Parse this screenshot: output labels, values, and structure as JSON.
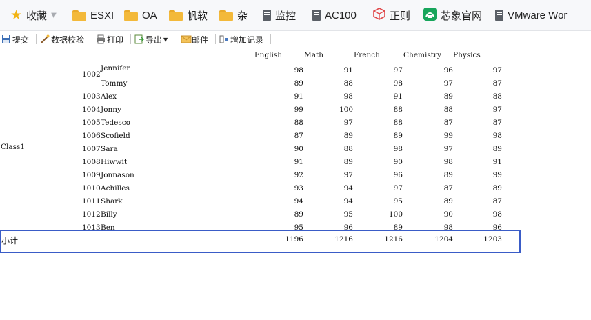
{
  "bookmarks": [
    {
      "label": "收藏",
      "icon": "star-icon"
    },
    {
      "label": "ESXI",
      "icon": "folder-icon"
    },
    {
      "label": "OA",
      "icon": "folder-icon"
    },
    {
      "label": "帆软",
      "icon": "folder-icon"
    },
    {
      "label": "杂",
      "icon": "folder-icon"
    },
    {
      "label": "监控",
      "icon": "document-icon"
    },
    {
      "label": "AC100",
      "icon": "document-icon"
    },
    {
      "label": "正则",
      "icon": "cube-icon"
    },
    {
      "label": "芯象官网",
      "icon": "green-app-icon"
    },
    {
      "label": "VMware Wor",
      "icon": "document-icon"
    }
  ],
  "toolbar": {
    "submit": "提交",
    "validate": "数据校验",
    "print": "打印",
    "export": "导出",
    "mail": "邮件",
    "add_record": "增加记录"
  },
  "report": {
    "columns": [
      "English",
      "Math",
      "French",
      "Chemistry",
      "Physics"
    ],
    "class_label": "Class1",
    "rows": [
      {
        "id": "1002",
        "name": "Jennifer",
        "scores": [
          98,
          91,
          97,
          96,
          97
        ]
      },
      {
        "id": "",
        "name": "Tommy",
        "scores": [
          89,
          88,
          98,
          97,
          87
        ]
      },
      {
        "id": "1003",
        "name": "Alex",
        "scores": [
          91,
          98,
          91,
          89,
          88
        ]
      },
      {
        "id": "1004",
        "name": "Jonny",
        "scores": [
          99,
          100,
          88,
          88,
          97
        ]
      },
      {
        "id": "1005",
        "name": "Tedesco",
        "scores": [
          88,
          97,
          88,
          87,
          87
        ]
      },
      {
        "id": "1006",
        "name": "Scofield",
        "scores": [
          87,
          89,
          89,
          99,
          98
        ]
      },
      {
        "id": "1007",
        "name": "Sara",
        "scores": [
          90,
          88,
          98,
          97,
          89
        ]
      },
      {
        "id": "1008",
        "name": "Hiwwit",
        "scores": [
          91,
          89,
          90,
          98,
          91
        ]
      },
      {
        "id": "1009",
        "name": "Jonnason",
        "scores": [
          92,
          97,
          96,
          89,
          99
        ]
      },
      {
        "id": "1010",
        "name": "Achilles",
        "scores": [
          93,
          94,
          97,
          87,
          89
        ]
      },
      {
        "id": "1011",
        "name": "Shark",
        "scores": [
          94,
          94,
          95,
          89,
          87
        ]
      },
      {
        "id": "1012",
        "name": "Billy",
        "scores": [
          89,
          95,
          100,
          90,
          98
        ]
      },
      {
        "id": "1013",
        "name": "Ben",
        "scores": [
          95,
          96,
          89,
          98,
          96
        ]
      }
    ],
    "subtotal_label": "小计",
    "subtotals": [
      1196,
      1216,
      1216,
      1204,
      1203
    ]
  }
}
